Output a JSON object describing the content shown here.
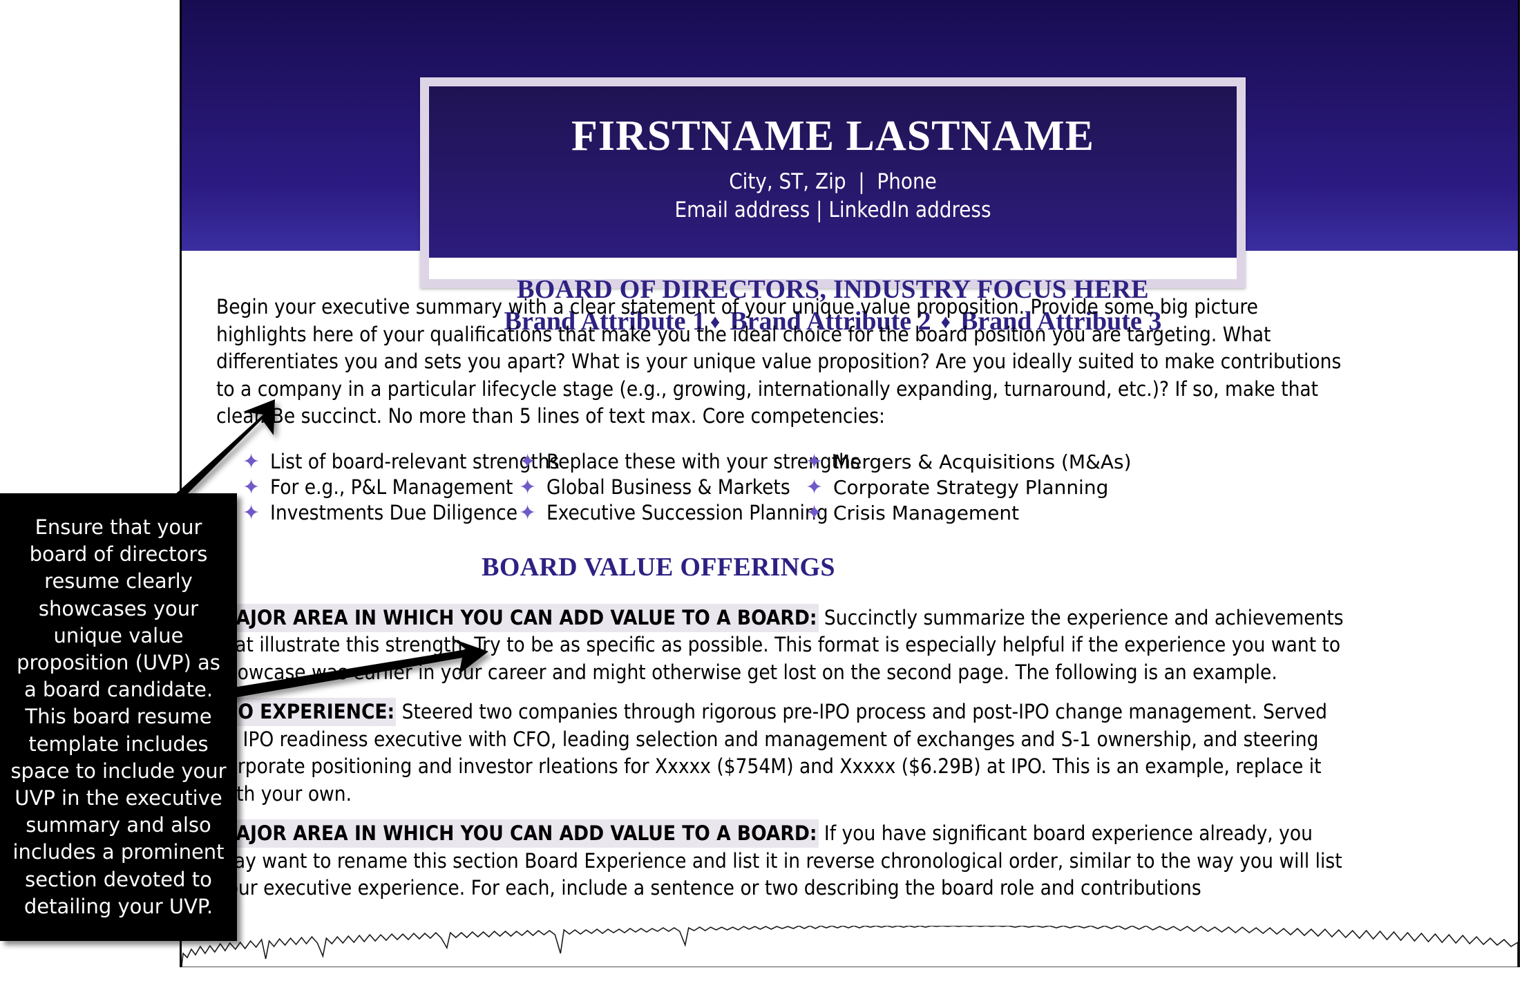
{
  "document": {
    "type": "board-of-directors-resume-template",
    "header": {
      "full_name": "FIRSTNAME LASTNAME",
      "contact_line_1": "City, ST, Zip  |  Phone",
      "contact_line_2": "Email address | LinkedIn address",
      "board_title": "BOARD OF DIRECTORS, INDUSTRY FOCUS HERE",
      "brand_attribute_1": "Brand Attribute 1",
      "brand_attribute_2": "Brand Attribute 2",
      "brand_attribute_3": "Brand Attribute 3",
      "separator": "♦"
    },
    "summary": {
      "paragraph": "Begin your executive summary with a clear statement of your unique value proposition. Provide some big picture highlights here of your qualifications that make you the ideal choice for the board position you are targeting. What differentiates you and sets you apart? What is your unique value proposition? Are you ideally suited to make contributions to a company in a particular lifecycle stage (e.g., growing, internationally expanding, turnaround, etc.)? If so, make that clear. Be succinct. No more than 5 lines of text max. Core competencies:"
    },
    "competencies": {
      "bullet_glyph": "✦",
      "column_1": [
        "List of board-relevant strengths",
        "For e.g., P&L Management",
        "Investments Due Diligence"
      ],
      "column_2": [
        "Replace these with your strengths",
        "Global Business & Markets",
        "Executive Succession Planning"
      ],
      "column_3": [
        "Mergers & Acquisitions (M&As)",
        "Corporate Strategy Planning",
        "Crisis Management"
      ]
    },
    "section_heading": "BOARD VALUE OFFERINGS",
    "value_offerings": [
      {
        "lead": "MAJOR AREA IN WHICH YOU CAN ADD VALUE TO A BOARD:",
        "body": " Succinctly summarize the experience and achievements that illustrate this strength. Try to be as specific as possible. This format is especially helpful if the experience you want to showcase was earlier in your career and might otherwise get lost on the second page. The following is an example."
      },
      {
        "lead": "IPO EXPERIENCE:",
        "body": " Steered two companies through rigorous pre-IPO process and post-IPO change management. Served as IPO readiness executive with CFO, leading selection and management of exchanges and S-1 ownership, and steering corporate positioning and investor rleations for Xxxxx ($754M) and Xxxxx ($6.29B) at IPO. This is an example, replace it with your own."
      },
      {
        "lead": "MAJOR AREA IN WHICH YOU CAN ADD VALUE TO A BOARD:",
        "body": " If you have significant board experience already, you may want to rename this section Board Experience and list it in reverse chronological order, similar to the way you will list your executive experience. For each, include a sentence or two describing the board role and contributions"
      }
    ]
  },
  "annotation": {
    "callout_text": "Ensure that your board of directors resume clearly showcases your unique value proposition (UVP) as a board candidate. This board resume template includes space to include  your UVP in the executive summary and also includes a prominent section  devoted to detailing your UVP."
  },
  "colors": {
    "banner_dark": "#170c52",
    "banner_light": "#3a2ea0",
    "heading_purple": "#2d2183",
    "bullet_purple": "#7159c8",
    "frame_lavender": "#ddd5e6",
    "highlight_gray": "#eae6ee",
    "callout_bg": "#000000"
  }
}
